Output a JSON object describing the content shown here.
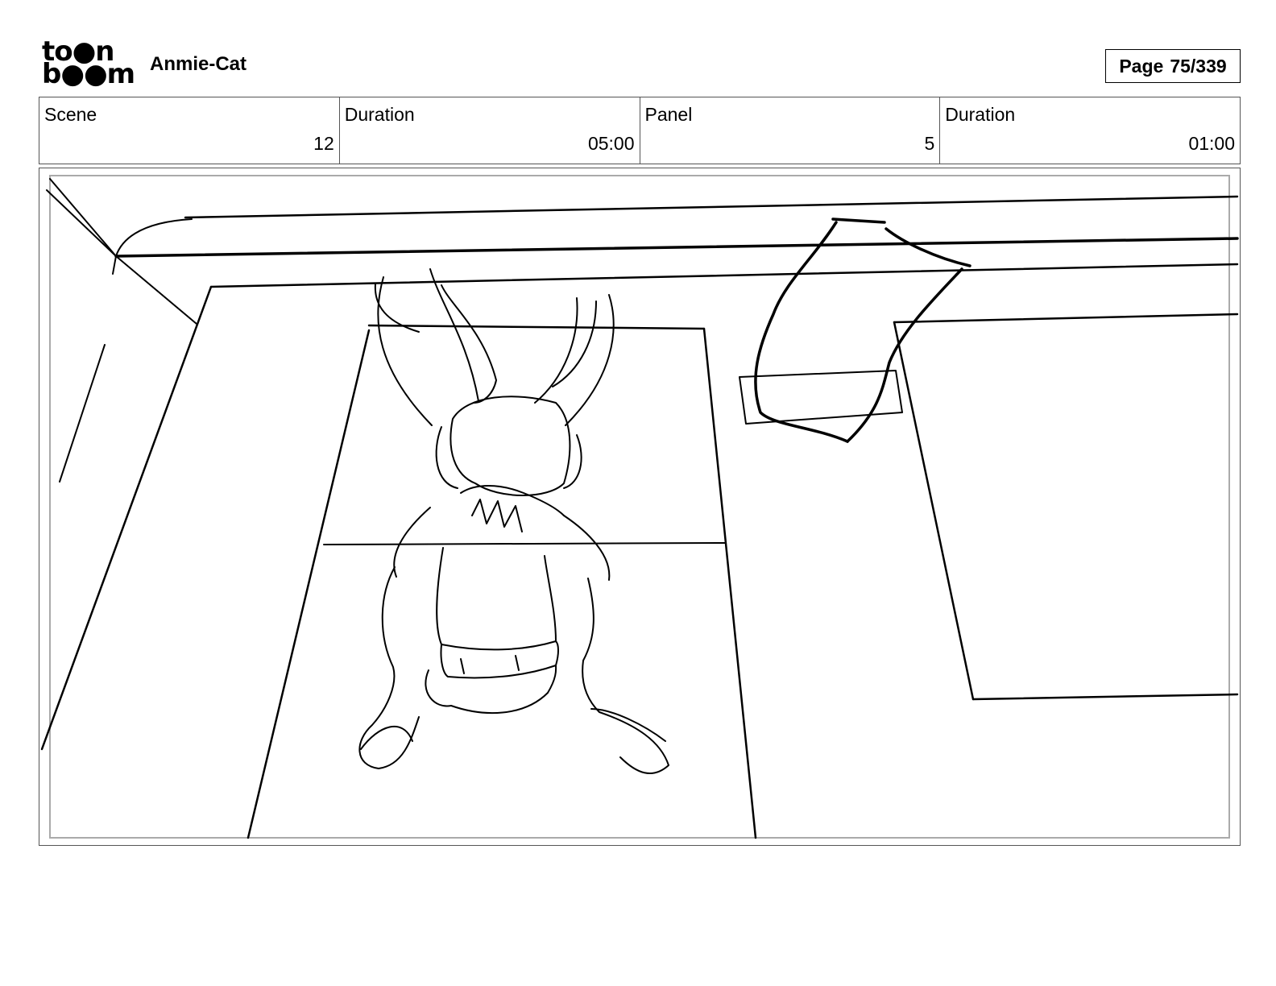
{
  "header": {
    "logo": {
      "line1": "to●n",
      "line2": "b●●m"
    },
    "project_title": "Anmie-Cat",
    "page": {
      "label": "Page",
      "number": "75/339"
    }
  },
  "info": {
    "scene": {
      "label": "Scene",
      "value": "12"
    },
    "scene_duration": {
      "label": "Duration",
      "value": "05:00"
    },
    "panel": {
      "label": "Panel",
      "value": "5"
    },
    "panel_duration": {
      "label": "Duration",
      "value": "01:00"
    }
  },
  "panel_image": {
    "ink_color": "#000000"
  }
}
